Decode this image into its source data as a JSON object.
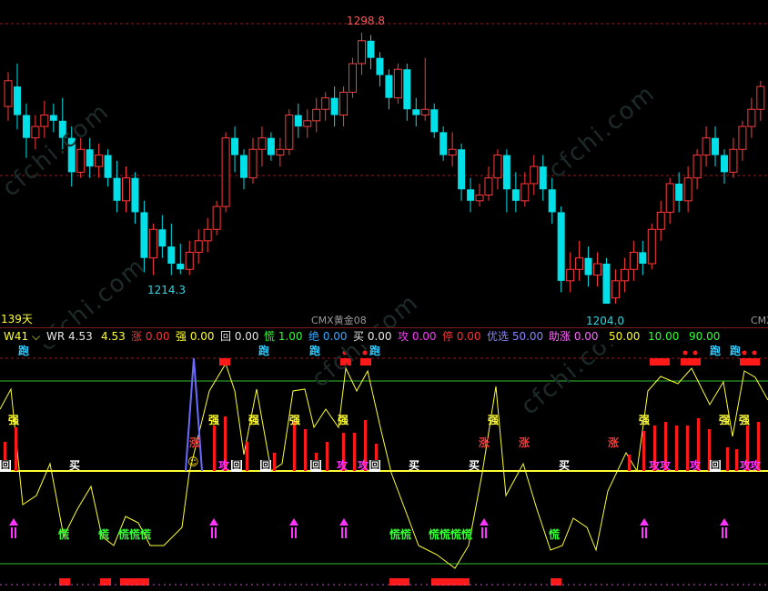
{
  "chart_info": {
    "days_label": "139天",
    "symbol_tag": "CMX黄金08",
    "symbol_tag_right": "CMX",
    "high_label": "1298.8",
    "low_label": "1214.3",
    "low_label_right": "1204.0",
    "watermark": "cfchi.com"
  },
  "indicator_header": {
    "selector": "W41",
    "items": [
      {
        "text": "WR 4.53",
        "color": "#e6e6e6"
      },
      {
        "text": "4.53",
        "color": "#ffff33"
      },
      {
        "text": "涨 0.00",
        "color": "#ff3333"
      },
      {
        "text": "强 0.00",
        "color": "#ffff33"
      },
      {
        "text": "回 0.00",
        "color": "#e6e6e6"
      },
      {
        "text": "慌 1.00",
        "color": "#33ff33"
      },
      {
        "text": "绝 0.00",
        "color": "#33aaff"
      },
      {
        "text": "买 0.00",
        "color": "#e6e6e6"
      },
      {
        "text": "攻 0.00",
        "color": "#ff33ff"
      },
      {
        "text": "停 0.00",
        "color": "#ff3333"
      },
      {
        "text": "优选 50.00",
        "color": "#8888ff"
      },
      {
        "text": "助涨 0.00",
        "color": "#ff66ff"
      },
      {
        "text": "50.00",
        "color": "#ffff33"
      },
      {
        "text": "10.00",
        "color": "#33ff33"
      },
      {
        "text": "90.00",
        "color": "#33ff33"
      }
    ]
  },
  "signals": {
    "run": "跑",
    "strong": "强",
    "rise": "涨",
    "buy": "买",
    "panic": "慌",
    "panic3": "慌慌慌",
    "panic2": "慌慌",
    "panic4": "慌慌慌慌",
    "attack": "攻",
    "back": "回",
    "smile": "☺"
  },
  "chart_data": {
    "type": "candlestick",
    "price_high": 1298.8,
    "price_low_left": 1214.3,
    "price_low_right": 1204.0,
    "candles": [
      [
        1273,
        1282,
        1268,
        1285
      ],
      [
        1280,
        1270,
        1265,
        1288
      ],
      [
        1270,
        1262,
        1255,
        1274
      ],
      [
        1262,
        1266,
        1258,
        1270
      ],
      [
        1266,
        1270,
        1262,
        1275
      ],
      [
        1270,
        1268,
        1264,
        1274
      ],
      [
        1268,
        1262,
        1258,
        1276
      ],
      [
        1262,
        1250,
        1245,
        1266
      ],
      [
        1250,
        1258,
        1248,
        1262
      ],
      [
        1258,
        1252,
        1248,
        1262
      ],
      [
        1252,
        1256,
        1248,
        1260
      ],
      [
        1256,
        1248,
        1245,
        1258
      ],
      [
        1248,
        1240,
        1236,
        1254
      ],
      [
        1240,
        1248,
        1236,
        1252
      ],
      [
        1248,
        1236,
        1232,
        1250
      ],
      [
        1236,
        1220,
        1215,
        1240
      ],
      [
        1220,
        1230,
        1214,
        1232
      ],
      [
        1230,
        1224,
        1220,
        1235
      ],
      [
        1224,
        1218,
        1214,
        1232
      ],
      [
        1218,
        1216,
        1214.3,
        1225
      ],
      [
        1216,
        1222,
        1214,
        1226
      ],
      [
        1222,
        1226,
        1218,
        1230
      ],
      [
        1226,
        1230,
        1222,
        1234
      ],
      [
        1230,
        1238,
        1228,
        1240
      ],
      [
        1238,
        1262,
        1236,
        1264
      ],
      [
        1262,
        1256,
        1250,
        1266
      ],
      [
        1256,
        1248,
        1244,
        1258
      ],
      [
        1248,
        1258,
        1246,
        1262
      ],
      [
        1258,
        1262,
        1252,
        1266
      ],
      [
        1262,
        1256,
        1254,
        1264
      ],
      [
        1256,
        1258,
        1252,
        1262
      ],
      [
        1258,
        1270,
        1256,
        1272
      ],
      [
        1270,
        1266,
        1262,
        1274
      ],
      [
        1266,
        1268,
        1262,
        1272
      ],
      [
        1268,
        1272,
        1264,
        1276
      ],
      [
        1272,
        1276,
        1268,
        1278
      ],
      [
        1276,
        1270,
        1266,
        1280
      ],
      [
        1270,
        1278,
        1266,
        1280
      ],
      [
        1278,
        1288,
        1276,
        1290
      ],
      [
        1288,
        1296,
        1284,
        1298.8
      ],
      [
        1296,
        1290,
        1286,
        1298
      ],
      [
        1290,
        1284,
        1280,
        1292
      ],
      [
        1284,
        1276,
        1272,
        1286
      ],
      [
        1276,
        1286,
        1274,
        1288
      ],
      [
        1286,
        1272,
        1268,
        1288
      ],
      [
        1272,
        1270,
        1266,
        1276
      ],
      [
        1270,
        1272,
        1268,
        1290
      ],
      [
        1272,
        1264,
        1262,
        1274
      ],
      [
        1264,
        1256,
        1254,
        1266
      ],
      [
        1256,
        1258,
        1252,
        1264
      ],
      [
        1258,
        1244,
        1240,
        1260
      ],
      [
        1244,
        1240,
        1236,
        1248
      ],
      [
        1240,
        1242,
        1238,
        1246
      ],
      [
        1242,
        1248,
        1240,
        1252
      ],
      [
        1248,
        1256,
        1244,
        1258
      ],
      [
        1256,
        1244,
        1236,
        1258
      ],
      [
        1244,
        1240,
        1236,
        1250
      ],
      [
        1240,
        1246,
        1238,
        1250
      ],
      [
        1246,
        1252,
        1242,
        1256
      ],
      [
        1252,
        1244,
        1240,
        1256
      ],
      [
        1244,
        1236,
        1232,
        1248
      ],
      [
        1236,
        1212,
        1208,
        1238
      ],
      [
        1212,
        1216,
        1208,
        1222
      ],
      [
        1216,
        1220,
        1212,
        1226
      ],
      [
        1220,
        1214,
        1210,
        1224
      ],
      [
        1214,
        1218,
        1210,
        1222
      ],
      [
        1218,
        1204,
        1204,
        1220
      ],
      [
        1206,
        1212,
        1204,
        1216
      ],
      [
        1212,
        1216,
        1208,
        1220
      ],
      [
        1216,
        1222,
        1212,
        1226
      ],
      [
        1222,
        1218,
        1214,
        1226
      ],
      [
        1218,
        1230,
        1216,
        1232
      ],
      [
        1230,
        1236,
        1226,
        1240
      ],
      [
        1236,
        1246,
        1232,
        1248
      ],
      [
        1246,
        1240,
        1236,
        1250
      ],
      [
        1240,
        1248,
        1236,
        1252
      ],
      [
        1248,
        1256,
        1244,
        1258
      ],
      [
        1256,
        1262,
        1252,
        1266
      ],
      [
        1262,
        1256,
        1252,
        1266
      ],
      [
        1256,
        1250,
        1246,
        1258
      ],
      [
        1250,
        1258,
        1248,
        1262
      ],
      [
        1258,
        1266,
        1254,
        1268
      ],
      [
        1266,
        1272,
        1262,
        1276
      ],
      [
        1272,
        1280,
        1268,
        1282
      ]
    ]
  }
}
